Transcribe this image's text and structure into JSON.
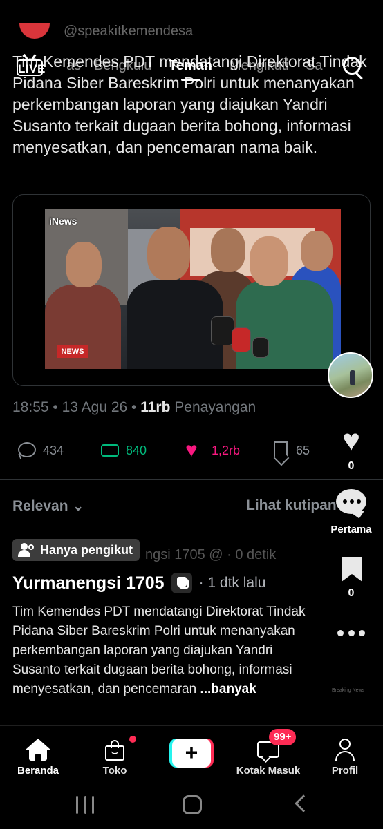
{
  "header": {
    "handle": "@speakitkemendesa",
    "live_label": "LIVE",
    "tabs": [
      {
        "label": "as"
      },
      {
        "label": "Bengkulu"
      },
      {
        "label": "Teman"
      },
      {
        "label": "Mengikuti"
      },
      {
        "label": "Sa"
      }
    ],
    "active_tab": "Teman"
  },
  "post": {
    "text": "Tim Kemendes PDT mendatangi Direktorat Tindak Pidana Siber Bareskrim Polri untuk menanyakan perkembangan laporan yang diajukan Yandri Susanto terkait dugaan berita bohong, informasi menyesatkan, dan pencemaran nama baik.",
    "media": {
      "logo": "iNews",
      "badge": "NEWS"
    },
    "time": "18:55",
    "date": "13 Agu 26",
    "views_count": "11rb",
    "views_label": "Penayangan",
    "stats": {
      "replies": "434",
      "reposts": "840",
      "likes": "1,2rb",
      "bookmarks": "65"
    }
  },
  "replies_section": {
    "sort_label": "Relevan",
    "quotes_label": "Lihat kutipan"
  },
  "overlay": {
    "followers_only": "Hanya pengikut",
    "ghost_line": "ngsi 1705 @ · 0 detik",
    "author": "Yurmanengsi 1705",
    "time_ago": "· 1 dtk lalu",
    "caption": "Tim Kemendes PDT mendatangi Direktorat Tindak Pidana Siber Bareskrim Polri untuk menanyakan perkembangan laporan yang diajukan Yandri Susanto terkait dugaan berita bohong, informasi menyesatkan, dan pencemaran ",
    "more_label": "...banyak",
    "watermark": "Breaking News"
  },
  "rail": {
    "likes": "0",
    "comment_label": "Pertama",
    "saves": "0"
  },
  "bottom_nav": {
    "home": "Beranda",
    "shop": "Toko",
    "inbox": "Kotak Masuk",
    "inbox_badge": "99+",
    "profile": "Profil"
  },
  "colors": {
    "like_pink": "#f91880",
    "repost_green": "#00ba7c",
    "tiktok_red": "#fe2c55",
    "tiktok_cyan": "#25f4ee"
  }
}
